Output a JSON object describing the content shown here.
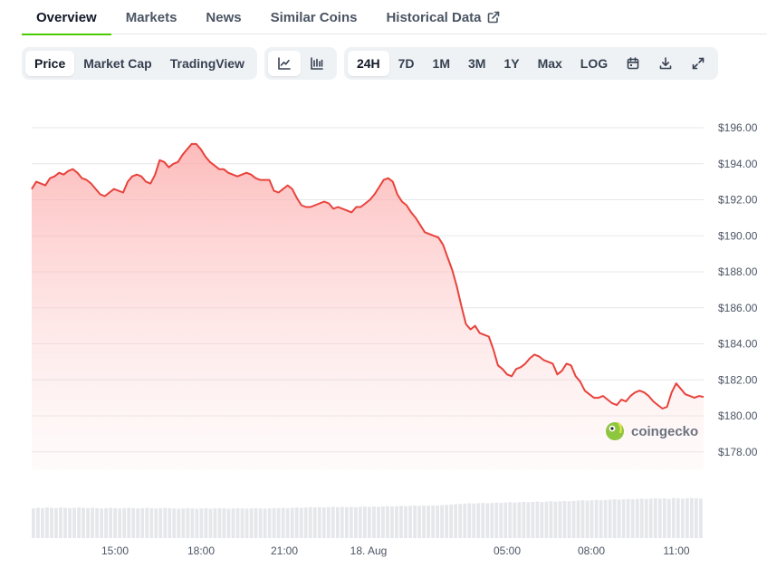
{
  "tabs": [
    {
      "label": "Overview",
      "active": true
    },
    {
      "label": "Markets",
      "active": false
    },
    {
      "label": "News",
      "active": false
    },
    {
      "label": "Similar Coins",
      "active": false
    },
    {
      "label": "Historical Data",
      "active": false,
      "icon": "external-link-icon"
    }
  ],
  "toolbar": {
    "metric_tabs": [
      {
        "label": "Price",
        "selected": true
      },
      {
        "label": "Market Cap",
        "selected": false
      },
      {
        "label": "TradingView",
        "selected": false
      }
    ],
    "chart_types": [
      {
        "icon": "line-chart-icon",
        "selected": true
      },
      {
        "icon": "candlestick-chart-icon",
        "selected": false
      }
    ],
    "ranges": [
      {
        "label": "24H",
        "selected": true
      },
      {
        "label": "7D",
        "selected": false
      },
      {
        "label": "1M",
        "selected": false
      },
      {
        "label": "3M",
        "selected": false
      },
      {
        "label": "1Y",
        "selected": false
      },
      {
        "label": "Max",
        "selected": false
      },
      {
        "label": "LOG",
        "selected": false
      }
    ],
    "actions": [
      {
        "icon": "calendar-icon"
      },
      {
        "icon": "download-icon"
      },
      {
        "icon": "fullscreen-icon"
      }
    ]
  },
  "watermark": "coingecko",
  "colors": {
    "line": "#e8433c",
    "fill_top": "#fca5a5",
    "accent_tab": "#4bcc00",
    "volume": "#e5e7eb"
  },
  "chart_data": {
    "type": "line",
    "series": [
      {
        "values": [
          192.6,
          193,
          192.9,
          192.8,
          193.2,
          193.3,
          193.5,
          193.4,
          193.6,
          193.7,
          193.5,
          193.2,
          193.1,
          192.9,
          192.6,
          192.3,
          192.2,
          192.4,
          192.6,
          192.5,
          192.4,
          193,
          193.3,
          193.4,
          193.3,
          193,
          192.9,
          193.4,
          194.2,
          194.1,
          193.8,
          194,
          194.1,
          194.5,
          194.8,
          195.1,
          195.1,
          194.8,
          194.4,
          194.1,
          193.9,
          193.7,
          193.7,
          193.5,
          193.4,
          193.3,
          193.4,
          193.5,
          193.4,
          193.2,
          193.1,
          193.1,
          193.1,
          192.5,
          192.4,
          192.6,
          192.8,
          192.6,
          192.1,
          191.7,
          191.6,
          191.6,
          191.7,
          191.8,
          191.9,
          191.8,
          191.5,
          191.6,
          191.5,
          191.4,
          191.3,
          191.6,
          191.6,
          191.8,
          192,
          192.3,
          192.7,
          193.1,
          193.2,
          193,
          192.3,
          191.9,
          191.7,
          191.3,
          191,
          190.6,
          190.2,
          190.1,
          190,
          189.9,
          189.5,
          188.8,
          188.1,
          187.2,
          186.1,
          185.1,
          184.8,
          185,
          184.6,
          184.5,
          184.4,
          183.7,
          182.8,
          182.6,
          182.3,
          182.2,
          182.6,
          182.7,
          182.9,
          183.2,
          183.4,
          183.3,
          183.1,
          183,
          182.9,
          182.3,
          182.5,
          182.9,
          182.8,
          182.2,
          181.9,
          181.4,
          181.2,
          181,
          181,
          181.1,
          180.9,
          180.7,
          180.6,
          180.9,
          180.8,
          181.1,
          181.3,
          181.4,
          181.3,
          181.1,
          180.8,
          180.6,
          180.4,
          180.5,
          181.3,
          181.8,
          181.5,
          181.2,
          181.1,
          181,
          181.1,
          181.05
        ]
      }
    ],
    "x_ticks": [
      "15:00",
      "18:00",
      "21:00",
      "18. Aug",
      "05:00",
      "08:00",
      "11:00"
    ],
    "y_ticks": [
      "$196.00",
      "$194.00",
      "$192.00",
      "$190.00",
      "$188.00",
      "$186.00",
      "$184.00",
      "$182.00",
      "$180.00",
      "$178.00"
    ],
    "ylim": [
      177,
      197
    ],
    "grid": true,
    "volume": {
      "values": [
        0.91,
        0.93,
        0.92,
        0.94,
        0.93,
        0.92,
        0.94,
        0.93,
        0.92,
        0.93,
        0.94,
        0.93,
        0.92,
        0.93,
        0.92,
        0.91,
        0.92,
        0.93,
        0.92,
        0.91,
        0.92,
        0.93,
        0.92,
        0.91,
        0.92,
        0.93,
        0.92,
        0.91,
        0.92,
        0.93,
        0.92,
        0.91,
        0.9,
        0.91,
        0.92,
        0.91,
        0.9,
        0.91,
        0.92,
        0.9,
        0.91,
        0.92,
        0.91,
        0.9,
        0.91,
        0.92,
        0.91,
        0.9,
        0.91,
        0.92,
        0.91,
        0.9,
        0.91,
        0.92,
        0.92,
        0.93,
        0.92,
        0.93,
        0.94,
        0.93,
        0.94,
        0.95,
        0.94,
        0.95,
        0.94,
        0.95,
        0.96,
        0.95,
        0.96,
        0.95,
        0.96,
        0.95,
        0.96,
        0.97,
        0.96,
        0.97,
        0.96,
        0.97,
        0.98,
        0.97,
        0.98,
        0.99,
        0.98,
        0.99,
        1.0,
        0.99,
        1.0,
        1.0,
        1.0,
        1.0,
        1.01,
        1.02,
        1.03,
        1.04,
        1.05,
        1.06,
        1.07,
        1.06,
        1.07,
        1.08,
        1.07,
        1.08,
        1.09,
        1.08,
        1.09,
        1.1,
        1.09,
        1.1,
        1.11,
        1.1,
        1.11,
        1.12,
        1.11,
        1.12,
        1.13,
        1.12,
        1.13,
        1.14,
        1.13,
        1.14,
        1.15,
        1.16,
        1.15,
        1.16,
        1.17,
        1.16,
        1.17,
        1.18,
        1.19,
        1.18,
        1.19,
        1.2,
        1.19,
        1.2,
        1.21,
        1.2,
        1.21,
        1.22,
        1.21,
        1.22,
        1.2,
        1.23,
        1.22,
        1.21,
        1.22,
        1.23,
        1.22,
        1.21
      ]
    }
  }
}
